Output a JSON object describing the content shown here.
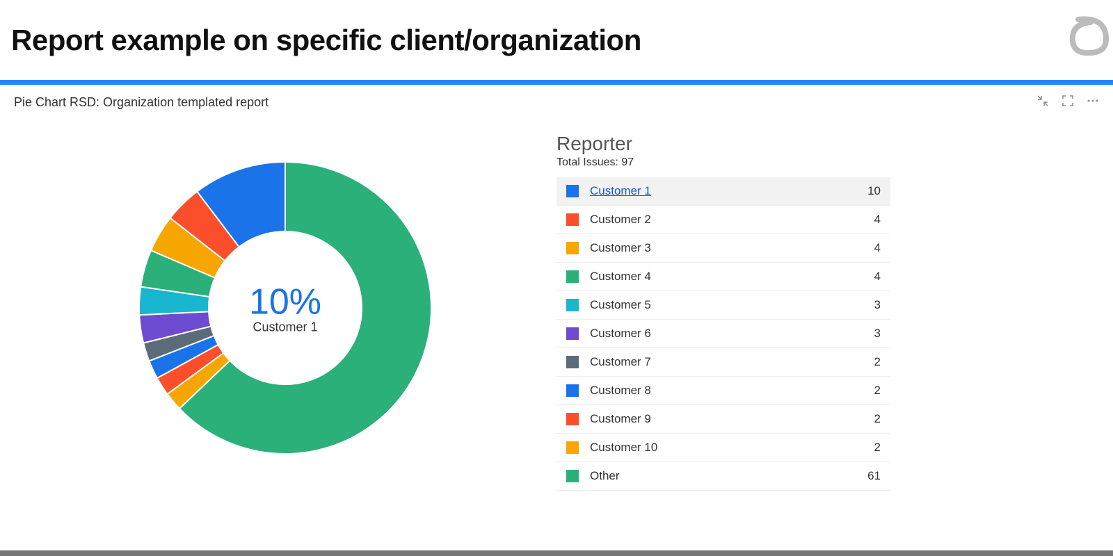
{
  "header": {
    "title": "Report example on specific client/organization"
  },
  "panel": {
    "title": "Pie Chart RSD: Organization templated report"
  },
  "legend": {
    "title": "Reporter",
    "subtitle": "Total Issues: 97"
  },
  "center": {
    "percent": "10%",
    "label": "Customer 1"
  },
  "chart_data": {
    "type": "pie",
    "title": "Reporter",
    "total_label": "Total Issues: 97",
    "total": 97,
    "highlighted_index": 0,
    "highlighted_percent": "10%",
    "series": [
      {
        "name": "Customer 1",
        "value": 10,
        "color": "#1a73e8"
      },
      {
        "name": "Customer 2",
        "value": 4,
        "color": "#fb4f2c"
      },
      {
        "name": "Customer 3",
        "value": 4,
        "color": "#f7a600"
      },
      {
        "name": "Customer 4",
        "value": 4,
        "color": "#2bb07a"
      },
      {
        "name": "Customer 5",
        "value": 3,
        "color": "#18b7cf"
      },
      {
        "name": "Customer 6",
        "value": 3,
        "color": "#6c4bd1"
      },
      {
        "name": "Customer 7",
        "value": 2,
        "color": "#5c6b78"
      },
      {
        "name": "Customer 8",
        "value": 2,
        "color": "#1a73e8"
      },
      {
        "name": "Customer 9",
        "value": 2,
        "color": "#fb4f2c"
      },
      {
        "name": "Customer 10",
        "value": 2,
        "color": "#f7a600"
      },
      {
        "name": "Other",
        "value": 61,
        "color": "#2bb07a"
      }
    ]
  }
}
